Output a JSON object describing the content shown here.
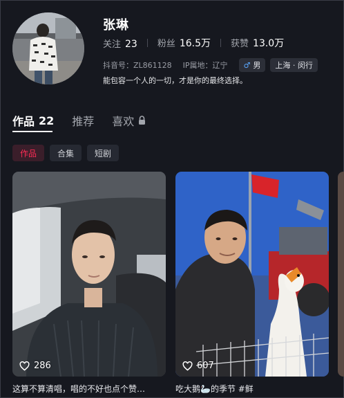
{
  "profile": {
    "name": "张琳",
    "stats": [
      {
        "label": "关注",
        "value": "23"
      },
      {
        "label": "粉丝",
        "value": "16.5万"
      },
      {
        "label": "获赞",
        "value": "13.0万"
      }
    ],
    "douyin_id": "抖音号：ZL861128",
    "ip_location": "IP属地：辽宁",
    "gender": "男",
    "gender_icon": "male-icon",
    "region": "上海 · 闵行",
    "bio": "能包容一个人的一切，才是你的最终选择。"
  },
  "tabs": [
    {
      "label": "作品",
      "count": "22",
      "active": true
    },
    {
      "label": "推荐",
      "count": "",
      "active": false
    },
    {
      "label": "喜欢",
      "count": "",
      "active": false,
      "icon": "lock-icon"
    }
  ],
  "subtabs": [
    {
      "label": "作品",
      "active": true
    },
    {
      "label": "合集",
      "active": false
    },
    {
      "label": "短剧",
      "active": false
    }
  ],
  "videos": [
    {
      "likes": "286",
      "caption": "这算不算清唱，唱的不好也点个赞…",
      "icon": "heart-icon"
    },
    {
      "likes": "607",
      "caption": "吃大鹅🦢的季节 #鲜",
      "icon": "heart-icon"
    }
  ],
  "colors": {
    "background": "#16181f",
    "accent": "#fe2c55",
    "male_badge": "#5aa8ff"
  }
}
